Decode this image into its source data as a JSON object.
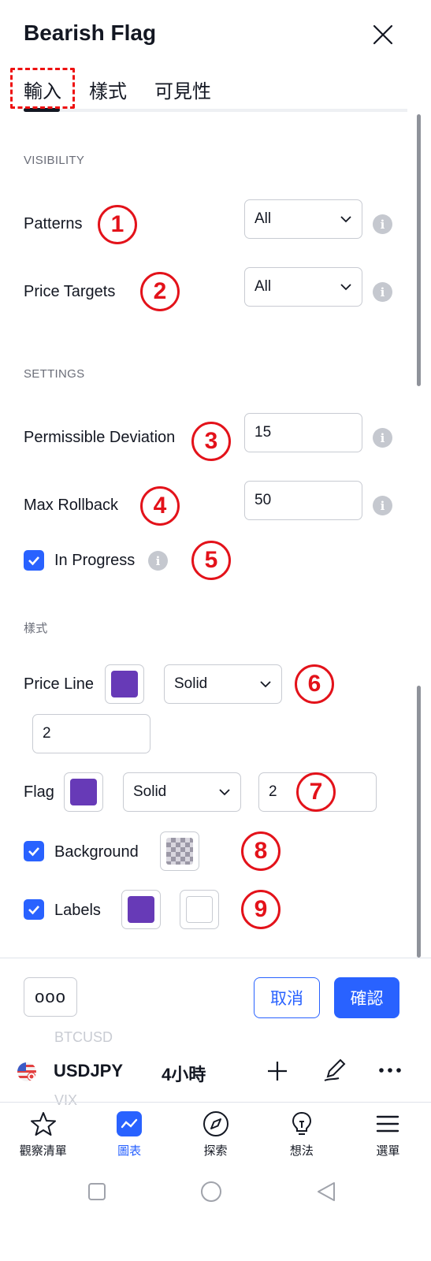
{
  "dialog": {
    "title": "Bearish Flag",
    "tabs": [
      "輸入",
      "樣式",
      "可見性"
    ],
    "active_tab": 0
  },
  "visibility": {
    "heading": "VISIBILITY",
    "patterns": {
      "label": "Patterns",
      "value": "All",
      "marker": "1"
    },
    "price_targets": {
      "label": "Price Targets",
      "value": "All",
      "marker": "2"
    }
  },
  "settings": {
    "heading": "SETTINGS",
    "permissible_deviation": {
      "label": "Permissible Deviation",
      "value": "15",
      "marker": "3"
    },
    "max_rollback": {
      "label": "Max Rollback",
      "value": "50",
      "marker": "4"
    },
    "in_progress": {
      "label": "In Progress",
      "checked": true,
      "marker": "5"
    }
  },
  "style": {
    "heading": "樣式",
    "price_line": {
      "label": "Price Line",
      "color": "#673ab7",
      "line_style": "Solid",
      "width": "2",
      "marker": "6"
    },
    "flag": {
      "label": "Flag",
      "color": "#673ab7",
      "line_style": "Solid",
      "width": "2",
      "marker": "7"
    },
    "background": {
      "label": "Background",
      "checked": true,
      "marker": "8"
    },
    "labels": {
      "label": "Labels",
      "checked": true,
      "color": "#673ab7",
      "text_color": "#ffffff",
      "marker": "9"
    }
  },
  "footer": {
    "more_label": "ooo",
    "cancel_label": "取消",
    "confirm_label": "確認"
  },
  "ticker_bar": {
    "prev_symbol": "BTCUSD",
    "symbol": "USDJPY",
    "interval": "4小時",
    "next_symbol": "VIX"
  },
  "bottom_nav": [
    {
      "label": "觀察清單",
      "icon": "star-icon",
      "active": false
    },
    {
      "label": "圖表",
      "icon": "chart-icon",
      "active": true
    },
    {
      "label": "探索",
      "icon": "compass-icon",
      "active": false
    },
    {
      "label": "想法",
      "icon": "lightbulb-icon",
      "active": false
    },
    {
      "label": "選單",
      "icon": "menu-icon",
      "active": false
    }
  ],
  "colors": {
    "accent": "#2962ff",
    "marker": "#e3121a",
    "swatch_purple": "#673ab7"
  }
}
